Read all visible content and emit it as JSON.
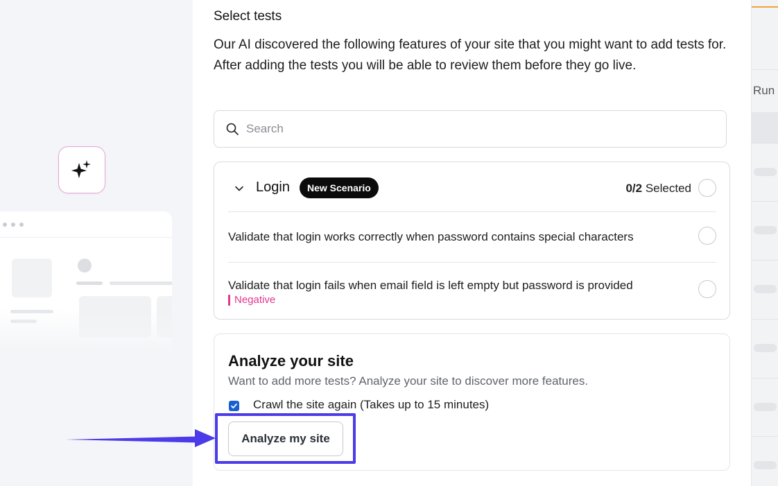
{
  "panel": {
    "section_label": "Select tests",
    "intro_text": "Our AI discovered the following features of your site that you might want to add tests for. After adding the tests you will be able to review them before they go live."
  },
  "search": {
    "placeholder": "Search",
    "icon": "search-icon"
  },
  "scenario": {
    "title": "Login",
    "badge": "New Scenario",
    "selected_count": "0/2",
    "selected_label": "Selected",
    "tests": [
      {
        "text": "Validate that login works correctly when password contains special characters",
        "tag": ""
      },
      {
        "text": "Validate that login fails when email field is left empty but password is provided",
        "tag": "Negative"
      }
    ]
  },
  "analyze": {
    "title": "Analyze your site",
    "subtitle": "Want to add more tests? Analyze your site to discover more features.",
    "checkbox_label": "Crawl the site again (Takes up to 15 minutes)",
    "checkbox_checked": true,
    "button_label": "Analyze my site"
  },
  "right_strip": {
    "run_label": "Run"
  },
  "colors": {
    "accent_highlight": "#4b3be8",
    "negative_tag": "#e0388f",
    "badge_bg": "#0b0b0b",
    "checkbox": "#1a5fd0"
  }
}
